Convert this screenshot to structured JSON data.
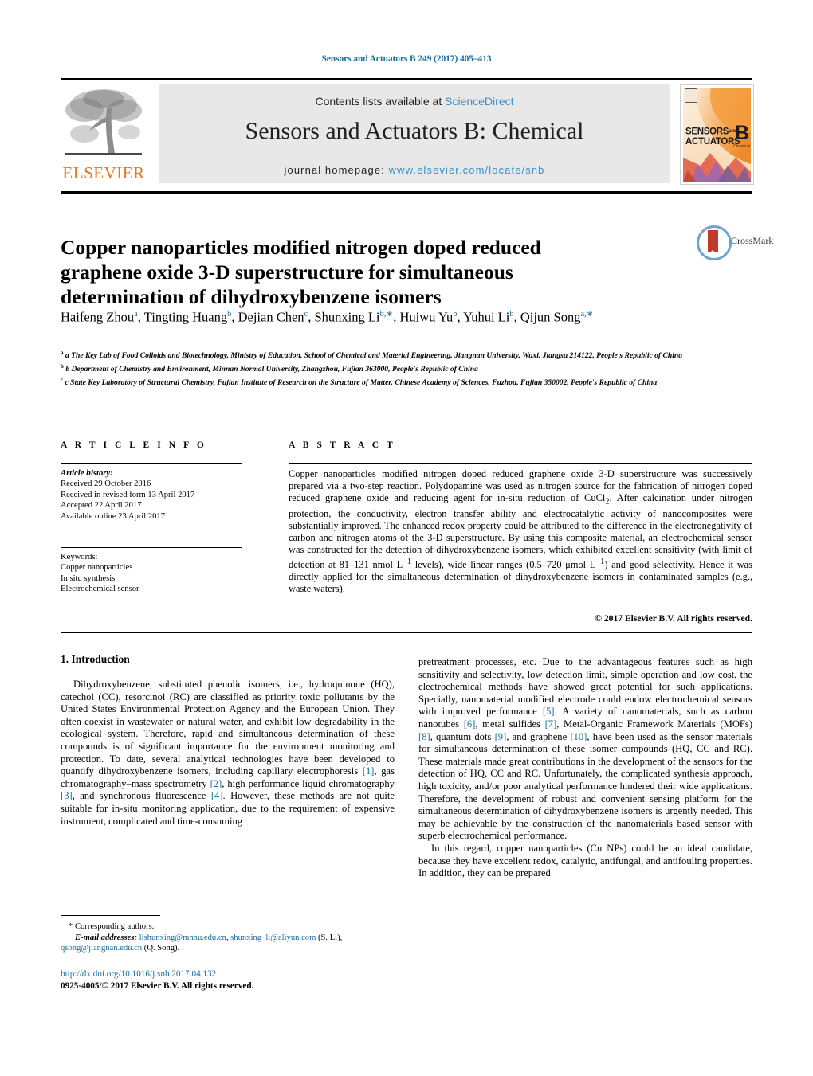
{
  "running_head": "Sensors and Actuators B 249 (2017) 405–413",
  "masthead": {
    "publisher_name": "ELSEVIER",
    "contents_prefix": "Contents lists available at ",
    "contents_link": "ScienceDirect",
    "journal_title": "Sensors and Actuators B: Chemical",
    "homepage_prefix": "journal homepage: ",
    "homepage_url": "www.elsevier.com/locate/snb",
    "cover": {
      "line1": "SENSORS",
      "line1_small": "and",
      "line2": "ACTUATORS",
      "letter": "B",
      "sublabel": "Chemical"
    }
  },
  "article": {
    "title": "Copper nanoparticles modified nitrogen doped reduced graphene oxide 3-D superstructure for simultaneous determination of dihydroxybenzene isomers",
    "crossmark_label": "CrossMark",
    "authors_html": "Haifeng Zhou<sup>a</sup>, Tingting Huang<sup>b</sup>, Dejian Chen<sup>c</sup>, Shunxing Li<sup>b,∗</sup>, Huiwu Yu<sup>b</sup>, Yuhui Li<sup>b</sup>, Qijun Song<sup>a,∗</sup>",
    "affiliations": [
      "a The Key Lab of Food Colloids and Biotechnology, Ministry of Education, School of Chemical and Material Engineering, Jiangnan University, Wuxi, Jiangsu 214122, People's Republic of China",
      "b Department of Chemistry and Environment, Minnan Normal University, Zhangzhou, Fujian 363000, People's Republic of China",
      "c State Key Laboratory of Structural Chemistry, Fujian Institute of Research on the Structure of Matter, Chinese Academy of Sciences, Fuzhou, Fujian 350002, People's Republic of China"
    ]
  },
  "article_info": {
    "heading": "A R T I C L E  I N F O",
    "history_label": "Article history:",
    "history": [
      "Received 29 October 2016",
      "Received in revised form 13 April 2017",
      "Accepted 22 April 2017",
      "Available online 23 April 2017"
    ],
    "keywords_label": "Keywords:",
    "keywords": [
      "Copper nanoparticles",
      "In situ synthesis",
      "Electrochemical sensor"
    ]
  },
  "abstract": {
    "heading": "A B S T R A C T",
    "text_html": "Copper nanoparticles modified nitrogen doped reduced graphene oxide 3-D superstructure was successively prepared via a two-step reaction. Polydopamine was used as nitrogen source for the fabrication of nitrogen doped reduced graphene oxide and reducing agent for in-situ reduction of CuCl<sub>2</sub>. After calcination under nitrogen protection, the conductivity, electron transfer ability and electrocatalytic activity of nanocomposites were substantially improved. The enhanced redox property could be attributed to the difference in the electronegativity of carbon and nitrogen atoms of the 3-D superstructure. By using this composite material, an electrochemical sensor was constructed for the detection of dihydroxybenzene isomers, which exhibited excellent sensitivity (with limit of detection at 81–131 nmol L<sup>−1</sup> levels), wide linear ranges (0.5–720 μmol L<sup>−1</sup>) and good selectivity. Hence it was directly applied for the simultaneous determination of dihydroxybenzene isomers in contaminated samples (e.g., waste waters).",
    "copyright": "© 2017 Elsevier B.V. All rights reserved."
  },
  "body": {
    "section_heading": "1.  Introduction",
    "left_paragraph_html": "Dihydroxybenzene, substituted phenolic isomers, i.e., hydroquinone (HQ), catechol (CC), resorcinol (RC) are classified as priority toxic pollutants by the United States Environmental Protection Agency and the European Union. They often coexist in wastewater or natural water, and exhibit low degradability in the ecological system. Therefore, rapid and simultaneous determination of these compounds is of significant importance for the environment monitoring and protection. To date, several analytical technologies have been developed to quantify dihydroxybenzene isomers, including capillary electrophoresis <span class=\"ref\">[1]</span>, gas chromatography–mass spectrometry <span class=\"ref\">[2]</span>, high performance liquid chromatography <span class=\"ref\">[3]</span>, and synchronous fluorescence <span class=\"ref\">[4]</span>. However, these methods are not quite suitable for in-situ monitoring application, due to the requirement of expensive instrument, complicated and time-consuming",
    "right_paragraph1_html": "pretreatment processes, etc. Due to the advantageous features such as high sensitivity and selectivity, low detection limit, simple operation and low cost, the electrochemical methods have showed great potential for such applications. Specially, nanomaterial modified electrode could endow electrochemical sensors with improved performance <span class=\"ref\">[5]</span>. A variety of nanomaterials, such as carbon nanotubes <span class=\"ref\">[6]</span>, metal sulfides <span class=\"ref\">[7]</span>, Metal-Organic Framework Materials (MOFs) <span class=\"ref\">[8]</span>, quantum dots <span class=\"ref\">[9]</span>, and graphene <span class=\"ref\">[10]</span>, have been used as the sensor materials for simultaneous determination of these isomer compounds (HQ, CC and RC). These materials made great contributions in the development of the sensors for the detection of HQ, CC and RC. Unfortunately, the complicated synthesis approach, high toxicity, and/or poor analytical performance hindered their wide applications. Therefore, the development of robust and convenient sensing platform for the simultaneous determination of dihydroxybenzene isomers is urgently needed. This may be achievable by the construction of the nanomaterials based sensor with superb electrochemical performance.",
    "right_paragraph2_html": "In this regard, copper nanoparticles (Cu NPs) could be an ideal candidate, because they have excellent redox, catalytic, antifungal, and antifouling properties. In addition, they can be prepared"
  },
  "footer": {
    "corresponding_note": "* Corresponding authors.",
    "email_label": "E-mail addresses:",
    "email1": "lishunxing@mnnu.edu.cn",
    "email2": "shunxing_li@aliyun.com",
    "email1_owner": "(S. Li),",
    "email3": "qsong@jiangnan.edu.cn",
    "email3_owner": "(Q. Song).",
    "doi": "http://dx.doi.org/10.1016/j.snb.2017.04.132",
    "issn_line": "0925-4005/© 2017 Elsevier B.V. All rights reserved."
  },
  "colors": {
    "link_blue": "#1a6f9e",
    "science_direct_blue": "#3a8fc4",
    "elsevier_orange": "#E87722",
    "masthead_grey": "#e8e8e8"
  }
}
